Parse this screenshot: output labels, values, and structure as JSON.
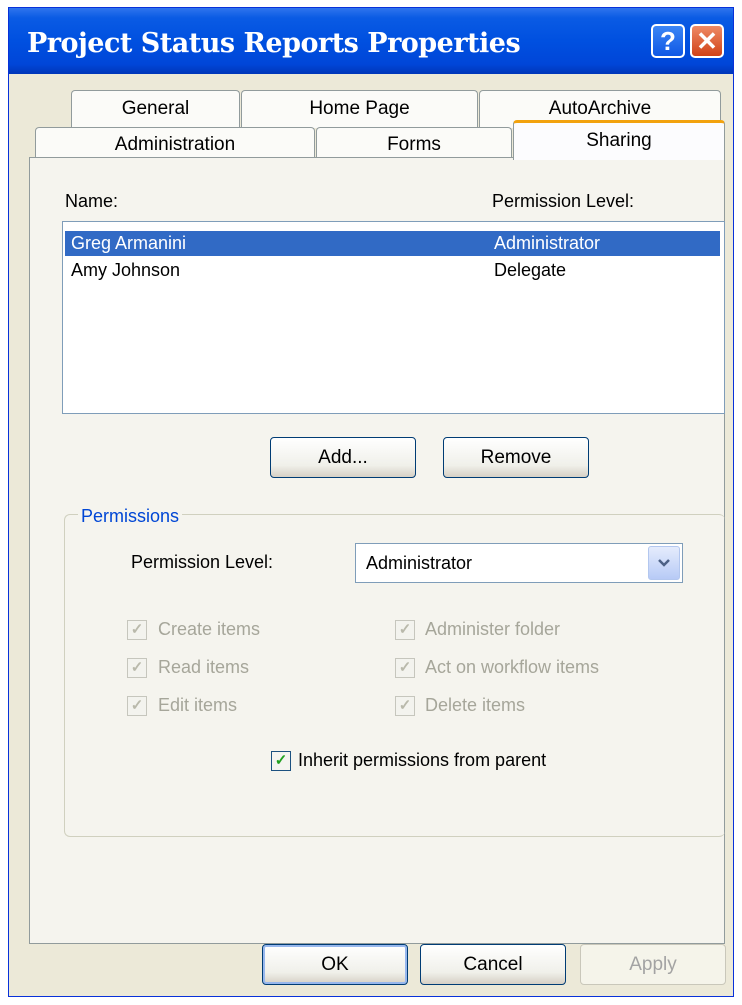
{
  "window": {
    "title": "Project Status Reports Properties",
    "help_glyph": "?",
    "close_glyph": "✕"
  },
  "tabs_row1": [
    "General",
    "Home Page",
    "AutoArchive"
  ],
  "tabs_row2": [
    "Administration",
    "Forms",
    "Sharing"
  ],
  "active_tab": "Sharing",
  "list": {
    "col_name": "Name:",
    "col_level": "Permission Level:",
    "rows": [
      {
        "name": "Greg Armanini",
        "level": "Administrator",
        "selected": true
      },
      {
        "name": "Amy Johnson",
        "level": "Delegate",
        "selected": false
      }
    ]
  },
  "buttons": {
    "add": "Add...",
    "remove": "Remove",
    "ok": "OK",
    "cancel": "Cancel",
    "apply": "Apply"
  },
  "permissions": {
    "group_label": "Permissions",
    "level_label": "Permission Level:",
    "level_value": "Administrator",
    "checkboxes": [
      {
        "label": "Create items",
        "checked": true,
        "enabled": false
      },
      {
        "label": "Read items",
        "checked": true,
        "enabled": false
      },
      {
        "label": "Edit items",
        "checked": true,
        "enabled": false
      },
      {
        "label": "Administer folder",
        "checked": true,
        "enabled": false
      },
      {
        "label": "Act on workflow items",
        "checked": true,
        "enabled": false
      },
      {
        "label": "Delete items",
        "checked": true,
        "enabled": false
      }
    ],
    "inherit_label": "Inherit permissions from parent",
    "inherit_checked": true
  },
  "colors": {
    "selection": "#316ac5",
    "titlebar": "#0050e0",
    "group_label": "#0046d5",
    "active_tab_accent": "#f2a20e"
  },
  "icons": {
    "dropdown": "chevron-down-icon",
    "check": "checkmark-icon"
  }
}
